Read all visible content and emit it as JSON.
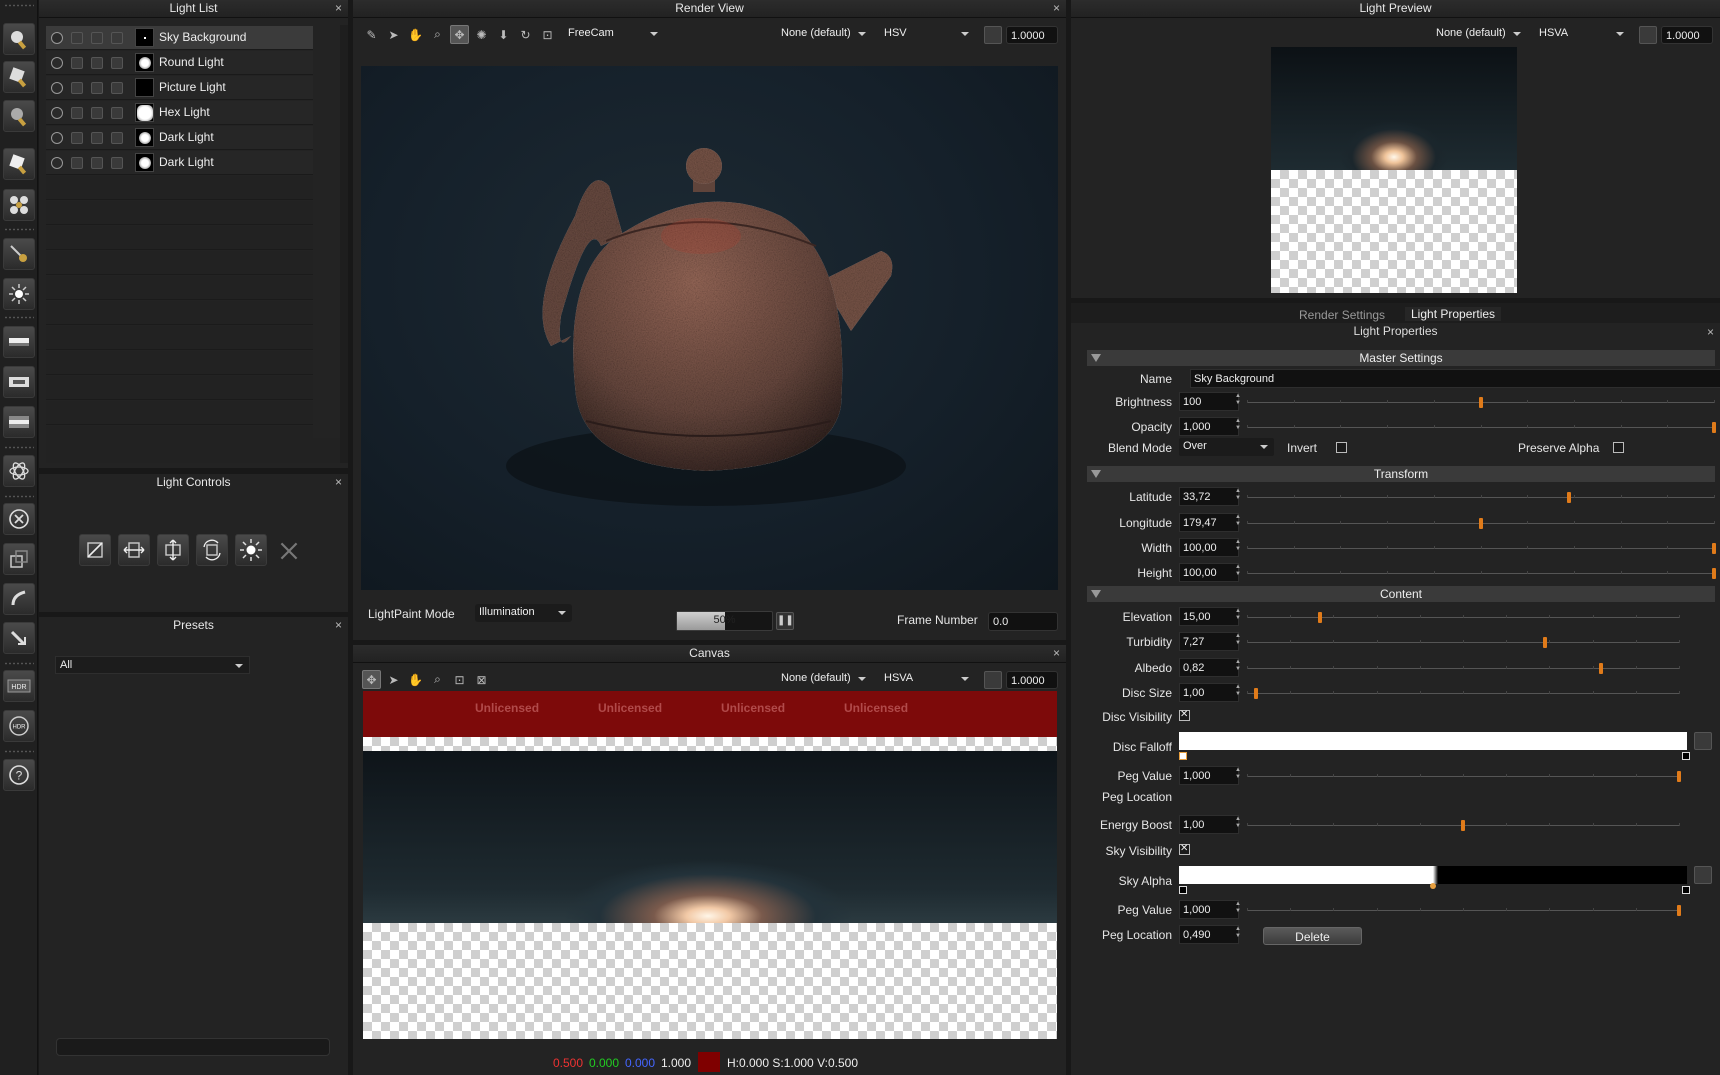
{
  "panels": {
    "light_list": "Light List",
    "render_view": "Render View",
    "light_preview": "Light Preview",
    "light_controls": "Light Controls",
    "presets": "Presets",
    "canvas": "Canvas",
    "light_properties": "Light Properties"
  },
  "close_glyph": "×",
  "lights": [
    {
      "name": "Sky Background",
      "selected": true,
      "thumb": "star"
    },
    {
      "name": "Round Light",
      "selected": false,
      "thumb": "round"
    },
    {
      "name": "Picture Light",
      "selected": false,
      "thumb": "black"
    },
    {
      "name": "Hex Light",
      "selected": false,
      "thumb": "hex"
    },
    {
      "name": "Dark Light",
      "selected": false,
      "thumb": "round"
    },
    {
      "name": "Dark Light",
      "selected": false,
      "thumb": "round"
    }
  ],
  "render_view": {
    "camera": "FreeCam",
    "colorspace": "None (default)",
    "mode": "HSV",
    "exposure": "1.0000",
    "lightpaint_mode_label": "LightPaint Mode",
    "lightpaint_mode": "Illumination",
    "progress_text": "50%",
    "progress": 0.5,
    "frame_label": "Frame Number",
    "frame_value": "0.0"
  },
  "light_preview": {
    "colorspace": "None (default)",
    "mode": "HSVA",
    "exposure": "1.0000"
  },
  "presets": {
    "filter": "All"
  },
  "canvas": {
    "colorspace": "None (default)",
    "mode": "HSVA",
    "exposure": "1.0000",
    "watermark": "Unlicensed",
    "status": {
      "r": "0.500",
      "g": "0.000",
      "b": "0.000",
      "a": "1.000",
      "hsv": "H:0.000 S:1.000 V:0.500",
      "swatch": "#7f0000"
    }
  },
  "tabs": [
    "Render Settings",
    "Light Properties"
  ],
  "props": {
    "master": "Master Settings",
    "transform": "Transform",
    "content": "Content",
    "name_label": "Name",
    "name": "Sky Background",
    "blend_label": "Blend Mode",
    "blend": "Over",
    "invert_label": "Invert",
    "preserve_label": "Preserve Alpha",
    "disc_vis_label": "Disc Visibility",
    "disc_falloff_label": "Disc Falloff",
    "peg_loc_label": "Peg Location",
    "sky_vis_label": "Sky Visibility",
    "sky_alpha_label": "Sky Alpha",
    "delete_label": "Delete",
    "sliders": [
      {
        "label": "Brightness",
        "value": "100",
        "pos": 0.5
      },
      {
        "label": "Opacity",
        "value": "1,000",
        "pos": 1.0
      },
      {
        "label": "Latitude",
        "value": "33,72",
        "pos": 0.69
      },
      {
        "label": "Longitude",
        "value": "179,47",
        "pos": 0.5
      },
      {
        "label": "Width",
        "value": "100,00",
        "pos": 1.0
      },
      {
        "label": "Height",
        "value": "100,00",
        "pos": 1.0
      },
      {
        "label": "Elevation",
        "value": "15,00",
        "pos": 0.17
      },
      {
        "label": "Turbidity",
        "value": "7,27",
        "pos": 0.69
      },
      {
        "label": "Albedo",
        "value": "0,82",
        "pos": 0.82
      },
      {
        "label": "Disc Size",
        "value": "1,00",
        "pos": 0.02
      },
      {
        "label": "Peg Value",
        "value": "1,000",
        "pos": 1.0
      },
      {
        "label": "Energy Boost",
        "value": "1,00",
        "pos": 0.5
      },
      {
        "label": "Peg Value",
        "value": "1,000",
        "pos": 1.0
      },
      {
        "label": "Peg Location",
        "value": "0,490",
        "pos": null
      }
    ]
  }
}
